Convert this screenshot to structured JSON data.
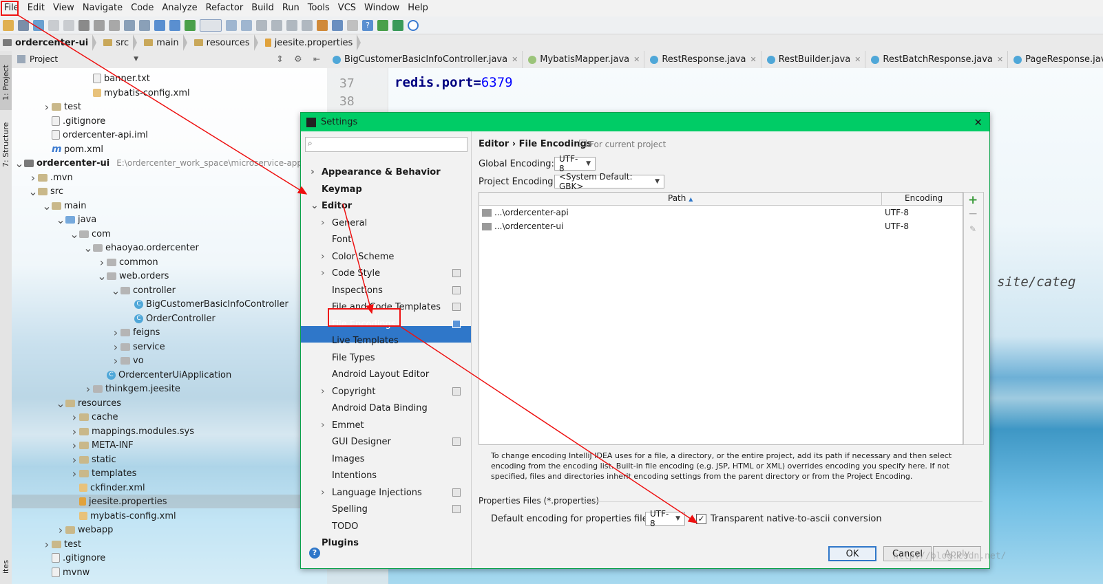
{
  "menu": [
    "File",
    "Edit",
    "View",
    "Navigate",
    "Code",
    "Analyze",
    "Refactor",
    "Build",
    "Run",
    "Tools",
    "VCS",
    "Window",
    "Help"
  ],
  "breadcrumb": [
    "ordercenter-ui",
    "src",
    "main",
    "resources",
    "jeesite.properties"
  ],
  "side_tabs": {
    "project": "1: Project",
    "structure": "7: Structure",
    "bottom": "ites"
  },
  "project_panel": {
    "title": "Project"
  },
  "tree": [
    {
      "label": "banner.txt",
      "extra": ""
    },
    {
      "label": "mybatis-config.xml",
      "extra": ""
    },
    {
      "label": "test",
      "extra": ""
    },
    {
      "label": ".gitignore",
      "extra": ""
    },
    {
      "label": "ordercenter-api.iml",
      "extra": ""
    },
    {
      "label": "pom.xml",
      "extra": ""
    },
    {
      "label": "ordercenter-ui",
      "extra": "E:\\ordercenter_work_space\\microservice-app-tem"
    },
    {
      "label": ".mvn",
      "extra": ""
    },
    {
      "label": "src",
      "extra": ""
    },
    {
      "label": "main",
      "extra": ""
    },
    {
      "label": "java",
      "extra": ""
    },
    {
      "label": "com",
      "extra": ""
    },
    {
      "label": "ehaoyao.ordercenter",
      "extra": ""
    },
    {
      "label": "common",
      "extra": ""
    },
    {
      "label": "web.orders",
      "extra": ""
    },
    {
      "label": "controller",
      "extra": ""
    },
    {
      "label": "BigCustomerBasicInfoController",
      "extra": ""
    },
    {
      "label": "OrderController",
      "extra": ""
    },
    {
      "label": "feigns",
      "extra": ""
    },
    {
      "label": "service",
      "extra": ""
    },
    {
      "label": "vo",
      "extra": ""
    },
    {
      "label": "OrdercenterUiApplication",
      "extra": ""
    },
    {
      "label": "thinkgem.jeesite",
      "extra": ""
    },
    {
      "label": "resources",
      "extra": ""
    },
    {
      "label": "cache",
      "extra": ""
    },
    {
      "label": "mappings.modules.sys",
      "extra": ""
    },
    {
      "label": "META-INF",
      "extra": ""
    },
    {
      "label": "static",
      "extra": ""
    },
    {
      "label": "templates",
      "extra": ""
    },
    {
      "label": "ckfinder.xml",
      "extra": ""
    },
    {
      "label": "jeesite.properties",
      "extra": ""
    },
    {
      "label": "mybatis-config.xml",
      "extra": ""
    },
    {
      "label": "webapp",
      "extra": ""
    },
    {
      "label": "test",
      "extra": ""
    },
    {
      "label": ".gitignore",
      "extra": ""
    },
    {
      "label": "mvnw",
      "extra": ""
    }
  ],
  "editor_tabs": [
    "BigCustomerBasicInfoController.java",
    "MybatisMapper.java",
    "RestResponse.java",
    "RestBuilder.java",
    "RestBatchResponse.java",
    "PageResponse.java"
  ],
  "editor": {
    "lines": [
      "37",
      "38"
    ],
    "code_key": "redis.port",
    "code_eq": "=",
    "code_val": "6379",
    "bg_text": "site/categ"
  },
  "dialog": {
    "title": "Settings",
    "search_placeholder": "",
    "breadcrumb_section": "Editor",
    "breadcrumb_sep": "›",
    "breadcrumb_page": "File Encodings",
    "scope_note": "For current project",
    "global_label": "Global Encoding:",
    "global_value": "UTF-8",
    "project_label": "Project Encoding:",
    "project_value": "<System Default: GBK>",
    "table": {
      "col_path": "Path",
      "col_encoding": "Encoding",
      "rows": [
        {
          "path": "...\\ordercenter-api",
          "encoding": "UTF-8"
        },
        {
          "path": "...\\ordercenter-ui",
          "encoding": "UTF-8"
        }
      ]
    },
    "help_text": "To change encoding IntelliJ IDEA uses for a file, a directory, or the entire project, add its path if necessary and then select encoding from the encoding list. Built-in file encoding (e.g. JSP, HTML or XML) overrides encoding you specify here. If not specified, files and directories inherit encoding settings from the parent directory or from the Project Encoding.",
    "props_section": "Properties Files (*.properties)",
    "props_label": "Default encoding for properties files:",
    "props_value": "UTF-8",
    "native_ascii_label": "Transparent native-to-ascii conversion",
    "native_ascii_checked": true,
    "ok": "OK",
    "cancel": "Cancel",
    "apply": "Apply",
    "watermark": "http://blog.csdn.net/"
  },
  "settings_tree": [
    {
      "label": "Appearance & Behavior",
      "bold": true,
      "arrow": "right"
    },
    {
      "label": "Keymap",
      "bold": true,
      "arrow": ""
    },
    {
      "label": "Editor",
      "bold": true,
      "arrow": "down"
    },
    {
      "label": "General",
      "bold": false,
      "arrow": "right"
    },
    {
      "label": "Font",
      "bold": false,
      "arrow": ""
    },
    {
      "label": "Color Scheme",
      "bold": false,
      "arrow": "right"
    },
    {
      "label": "Code Style",
      "bold": false,
      "arrow": "right",
      "copy": true
    },
    {
      "label": "Inspections",
      "bold": false,
      "arrow": "",
      "copy": true
    },
    {
      "label": "File and Code Templates",
      "bold": false,
      "arrow": "",
      "copy": true
    },
    {
      "label": "File Encodings",
      "bold": false,
      "arrow": "",
      "copy": true,
      "selected": true
    },
    {
      "label": "Live Templates",
      "bold": false,
      "arrow": ""
    },
    {
      "label": "File Types",
      "bold": false,
      "arrow": ""
    },
    {
      "label": "Android Layout Editor",
      "bold": false,
      "arrow": ""
    },
    {
      "label": "Copyright",
      "bold": false,
      "arrow": "right",
      "copy": true
    },
    {
      "label": "Android Data Binding",
      "bold": false,
      "arrow": ""
    },
    {
      "label": "Emmet",
      "bold": false,
      "arrow": "right"
    },
    {
      "label": "GUI Designer",
      "bold": false,
      "arrow": "",
      "copy": true
    },
    {
      "label": "Images",
      "bold": false,
      "arrow": ""
    },
    {
      "label": "Intentions",
      "bold": false,
      "arrow": ""
    },
    {
      "label": "Language Injections",
      "bold": false,
      "arrow": "right",
      "copy": true
    },
    {
      "label": "Spelling",
      "bold": false,
      "arrow": "",
      "copy": true
    },
    {
      "label": "TODO",
      "bold": false,
      "arrow": ""
    },
    {
      "label": "Plugins",
      "bold": true,
      "arrow": ""
    }
  ],
  "colors": {
    "accent": "#2f77c9",
    "dialog_title": "#00cc66",
    "annotation": "#e11111"
  }
}
